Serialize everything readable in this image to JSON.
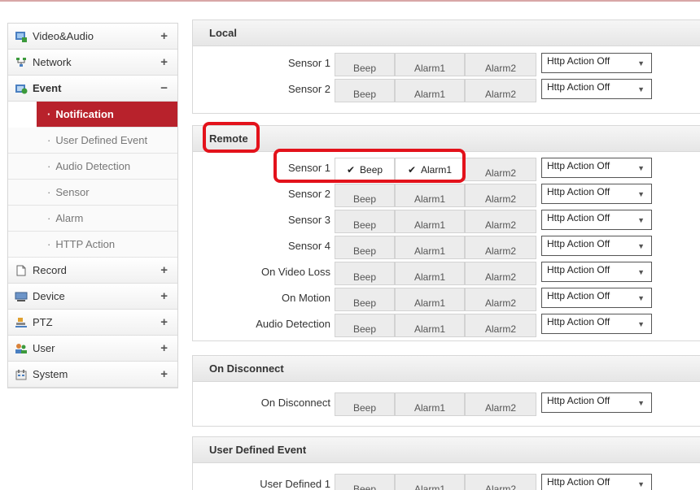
{
  "sidebar": {
    "items": [
      {
        "label": "Video&Audio",
        "toggle": "+",
        "icon": "video-audio-icon"
      },
      {
        "label": "Network",
        "toggle": "+",
        "icon": "network-icon"
      },
      {
        "label": "Event",
        "toggle": "−",
        "icon": "event-icon"
      },
      {
        "label": "Record",
        "toggle": "+",
        "icon": "record-icon"
      },
      {
        "label": "Device",
        "toggle": "+",
        "icon": "device-icon"
      },
      {
        "label": "PTZ",
        "toggle": "+",
        "icon": "ptz-icon"
      },
      {
        "label": "User",
        "toggle": "+",
        "icon": "user-icon"
      },
      {
        "label": "System",
        "toggle": "+",
        "icon": "system-icon"
      }
    ],
    "event_sub": [
      {
        "label": "Notification",
        "active": true
      },
      {
        "label": "User Defined Event"
      },
      {
        "label": "Audio Detection"
      },
      {
        "label": "Sensor"
      },
      {
        "label": "Alarm"
      },
      {
        "label": "HTTP Action"
      }
    ]
  },
  "buttons": {
    "beep": "Beep",
    "alarm1": "Alarm1",
    "alarm2": "Alarm2"
  },
  "http_action_value": "Http Action Off",
  "sections": {
    "local": {
      "title": "Local",
      "rows": [
        "Sensor 1",
        "Sensor 2"
      ]
    },
    "remote": {
      "title": "Remote",
      "rows": [
        "Sensor 1",
        "Sensor 2",
        "Sensor 3",
        "Sensor 4",
        "On Video Loss",
        "On Motion",
        "Audio Detection"
      ]
    },
    "on_disconnect": {
      "title": "On Disconnect",
      "rows": [
        "On Disconnect"
      ]
    },
    "user_defined": {
      "title": "User Defined Event",
      "rows": [
        "User Defined 1"
      ]
    }
  },
  "colors": {
    "accent": "#b8222c",
    "highlight": "#e3121b"
  }
}
